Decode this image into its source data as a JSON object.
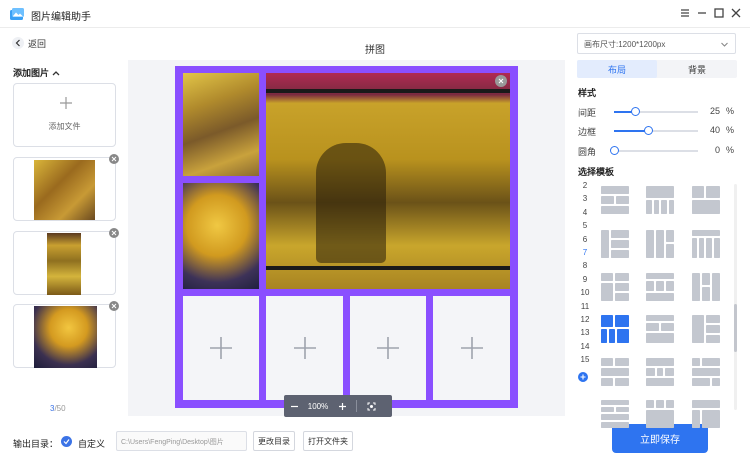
{
  "app": {
    "title": "图片编辑助手",
    "logo_icon": "image-stack-icon"
  },
  "window": {
    "pin_icon": "pin-icon",
    "minimize_icon": "minimize-icon",
    "maximize_icon": "maximize-icon",
    "close_icon": "close-icon"
  },
  "nav": {
    "back_label": "返回"
  },
  "left_panel": {
    "add_title": "添加图片",
    "add_file_label": "添加文件",
    "page_current": "3",
    "page_total": "/50"
  },
  "canvas": {
    "title": "拼图",
    "zoom": "100%"
  },
  "bottom": {
    "output_label": "输出目录：",
    "custom_label": "自定义",
    "path": "C:\\Users\\FengPing\\Desktop\\图片",
    "change_dir": "更改目录",
    "open_folder": "打开文件夹",
    "save": "立即保存"
  },
  "right_panel": {
    "canvas_size": "画布尺寸:1200*1200px",
    "tabs": [
      "布局",
      "背景"
    ],
    "style_title": "样式",
    "sliders": [
      {
        "name": "间距",
        "value": 25,
        "unit": "%"
      },
      {
        "name": "边框",
        "value": 40,
        "unit": "%"
      },
      {
        "name": "圆角",
        "value": 0,
        "unit": "%"
      }
    ],
    "template_title": "选择模板",
    "numbers": [
      "2",
      "3",
      "4",
      "5",
      "6",
      "7",
      "8",
      "9",
      "10",
      "11",
      "12",
      "13",
      "14",
      "15"
    ],
    "active_number": "7"
  },
  "colors": {
    "accent": "#2e74f0",
    "frame": "#8a4fff",
    "template_gray": "#c3c7cf"
  }
}
